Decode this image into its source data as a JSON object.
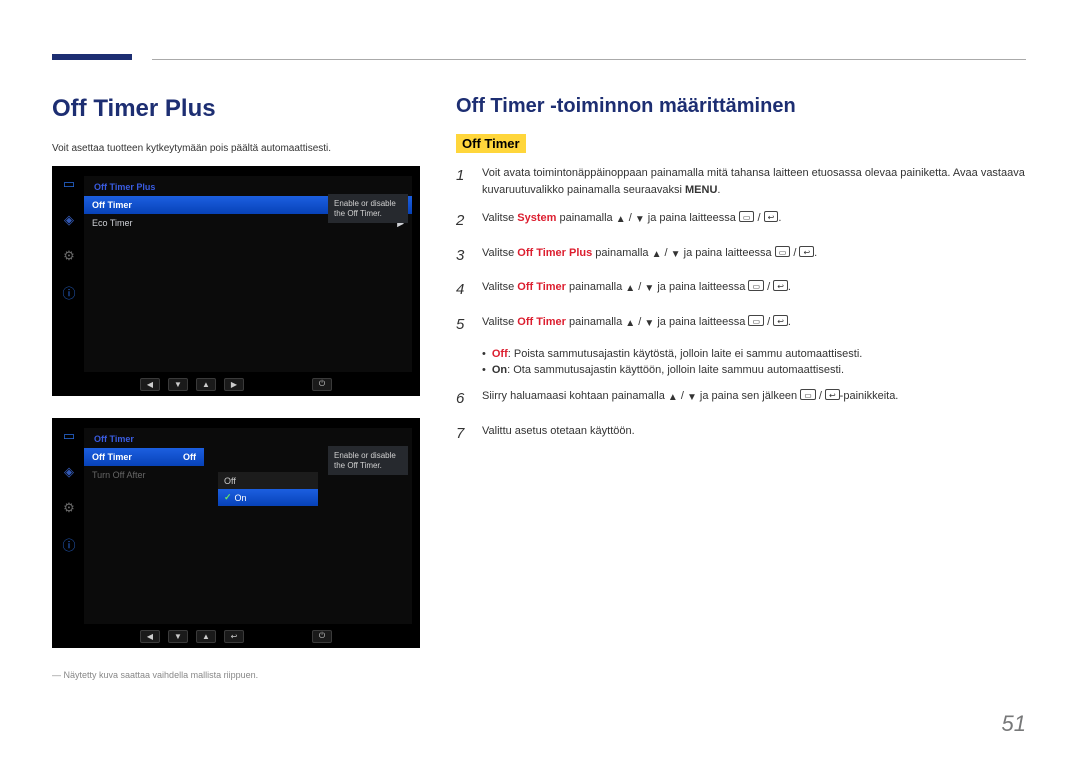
{
  "page_number": "51",
  "left": {
    "title": "Off Timer Plus",
    "intro": "Voit asettaa tuotteen kytkeytymään pois päältä automaattisesti.",
    "note": "― Näytetty kuva saattaa vaihdella mallista riippuen.",
    "osd1": {
      "title": "Off Timer Plus",
      "rows": [
        {
          "label": "Off Timer",
          "selected": true
        },
        {
          "label": "Eco Timer",
          "selected": false
        }
      ],
      "tooltip": "Enable or disable the Off Timer."
    },
    "osd2": {
      "title": "Off Timer",
      "rows": [
        {
          "label": "Off Timer",
          "value": "Off",
          "selected": true
        },
        {
          "label": "Turn Off After",
          "value": "",
          "selected": false
        }
      ],
      "dropdown": {
        "off": "Off",
        "on": "On"
      },
      "tooltip": "Enable or disable the Off Timer."
    }
  },
  "right": {
    "heading": "Off Timer -toiminnon määrittäminen",
    "subhead": "Off Timer",
    "steps": [
      {
        "num": "1",
        "pre": "Voit avata toimintonäppäinoppaan painamalla mitä tahansa laitteen etuosassa olevaa painiketta. Avaa vastaava kuvaruutuvalikko painamalla seuraavaksi ",
        "menu": "MENU",
        "post": "."
      },
      {
        "num": "2",
        "pre": "Valitse ",
        "bold_red": "System",
        "mid": " painamalla ",
        "controls": true,
        "post": " ja paina laitteessa "
      },
      {
        "num": "3",
        "pre": "Valitse ",
        "bold_red": "Off Timer Plus",
        "mid": " painamalla ",
        "controls": true,
        "post": " ja paina laitteessa "
      },
      {
        "num": "4",
        "pre": "Valitse ",
        "bold_red": "Off Timer",
        "mid": " painamalla ",
        "controls": true,
        "post": " ja paina laitteessa "
      },
      {
        "num": "5",
        "pre": "Valitse ",
        "bold_red": "Off Timer",
        "mid": " painamalla ",
        "controls": true,
        "post": " ja paina laitteessa "
      }
    ],
    "bullets": [
      {
        "keyword": "Off",
        "text": ": Poista sammutusajastin käytöstä, jolloin laite ei sammu automaattisesti."
      },
      {
        "keyword": "On",
        "text": ": Ota sammutusajastin käyttöön, jolloin laite sammuu automaattisesti."
      }
    ],
    "step6": {
      "num": "6",
      "pre": "Siirry haluamaasi kohtaan painamalla ",
      "mid": " ja paina sen jälkeen ",
      "post": "-painikkeita."
    },
    "step7": {
      "num": "7",
      "text": "Valittu asetus otetaan käyttöön."
    }
  }
}
